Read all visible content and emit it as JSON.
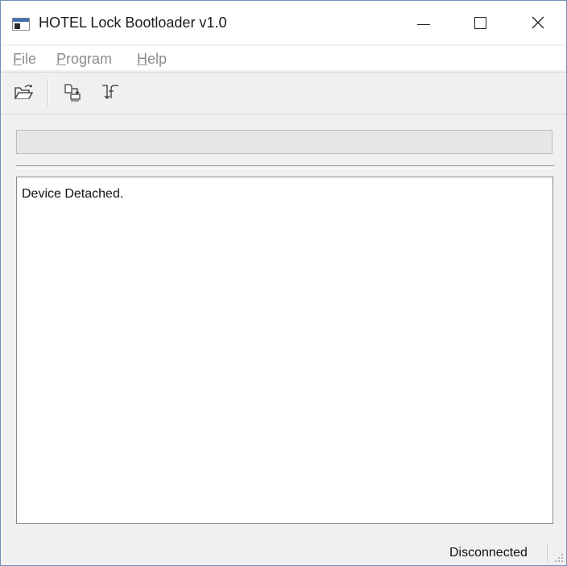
{
  "window": {
    "title": "HOTEL Lock Bootloader v1.0"
  },
  "menu": {
    "items": [
      {
        "label_first": "F",
        "label_rest": "ile"
      },
      {
        "label_first": "P",
        "label_rest": "rogram"
      },
      {
        "label_first": "H",
        "label_rest": "elp"
      }
    ],
    "disabled_color": "#8c8c8c"
  },
  "toolbar": {
    "buttons": [
      {
        "icon": "open-folder-icon"
      },
      {
        "icon": "program-device-icon"
      },
      {
        "icon": "reset-device-icon"
      }
    ]
  },
  "progress": {
    "value": 0
  },
  "log": {
    "lines": [
      "Device Detached."
    ]
  },
  "status": {
    "text": "Disconnected"
  },
  "colors": {
    "accent": "#3a6fb0"
  }
}
